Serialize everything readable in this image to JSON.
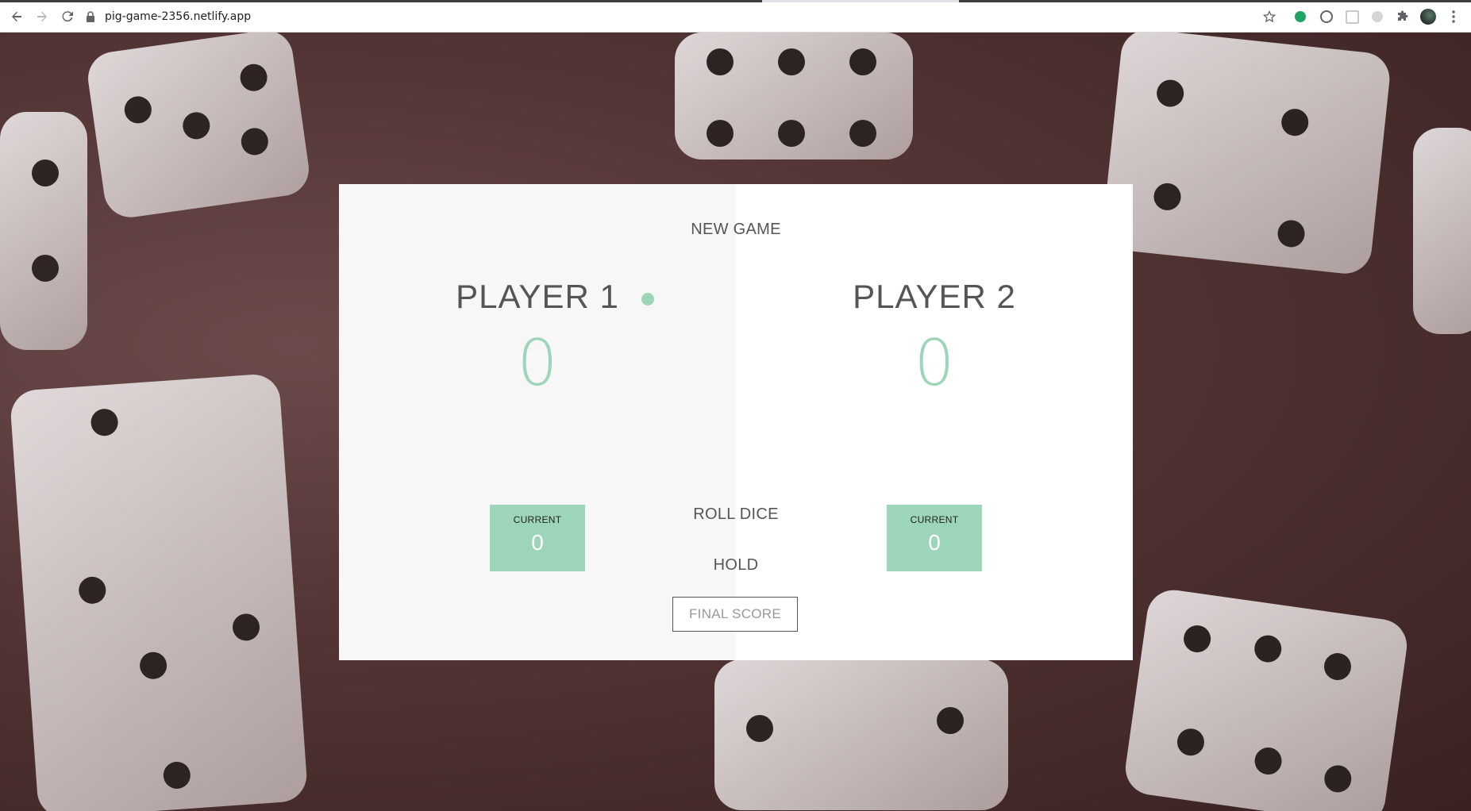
{
  "browser": {
    "url": "pig-game-2356.netlify.app"
  },
  "game": {
    "new_game_label": "NEW GAME",
    "roll_dice_label": "ROLL DICE",
    "hold_label": "HOLD",
    "final_score_placeholder": "FINAL SCORE",
    "active_player": 1,
    "players": [
      {
        "name": "PLAYER 1",
        "score": "0",
        "current_label": "CURRENT",
        "current_score": "0"
      },
      {
        "name": "PLAYER 2",
        "score": "0",
        "current_label": "CURRENT",
        "current_score": "0"
      }
    ]
  },
  "colors": {
    "accent": "#9dd5b9",
    "panel_left": "#f7f7f7",
    "panel_right": "#ffffff",
    "text": "#555555"
  }
}
